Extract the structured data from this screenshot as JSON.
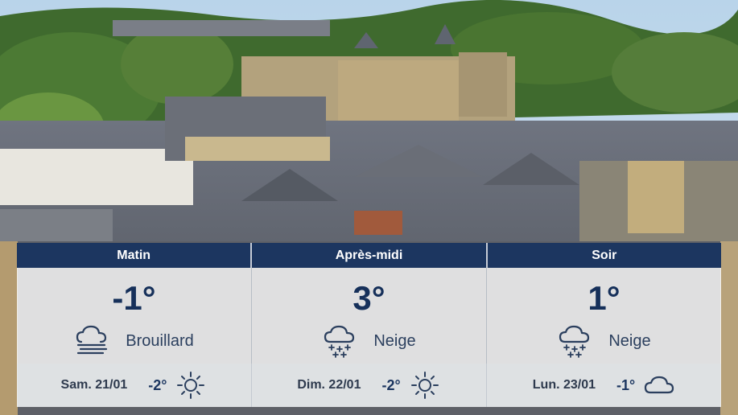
{
  "colors": {
    "header_bg": "#1c3660",
    "temp_text": "#16305a"
  },
  "periods": [
    {
      "label": "Matin",
      "temp": "-1°",
      "condition": "Brouillard",
      "icon": "fog-icon"
    },
    {
      "label": "Après-midi",
      "temp": "3°",
      "condition": "Neige",
      "icon": "snow-icon"
    },
    {
      "label": "Soir",
      "temp": "1°",
      "condition": "Neige",
      "icon": "snow-icon"
    }
  ],
  "forecast": [
    {
      "day": "Sam. 21/01",
      "temp": "-2°",
      "icon": "sun-icon"
    },
    {
      "day": "Dim. 22/01",
      "temp": "-2°",
      "icon": "sun-icon"
    },
    {
      "day": "Lun. 23/01",
      "temp": "-1°",
      "icon": "cloud-icon"
    }
  ]
}
